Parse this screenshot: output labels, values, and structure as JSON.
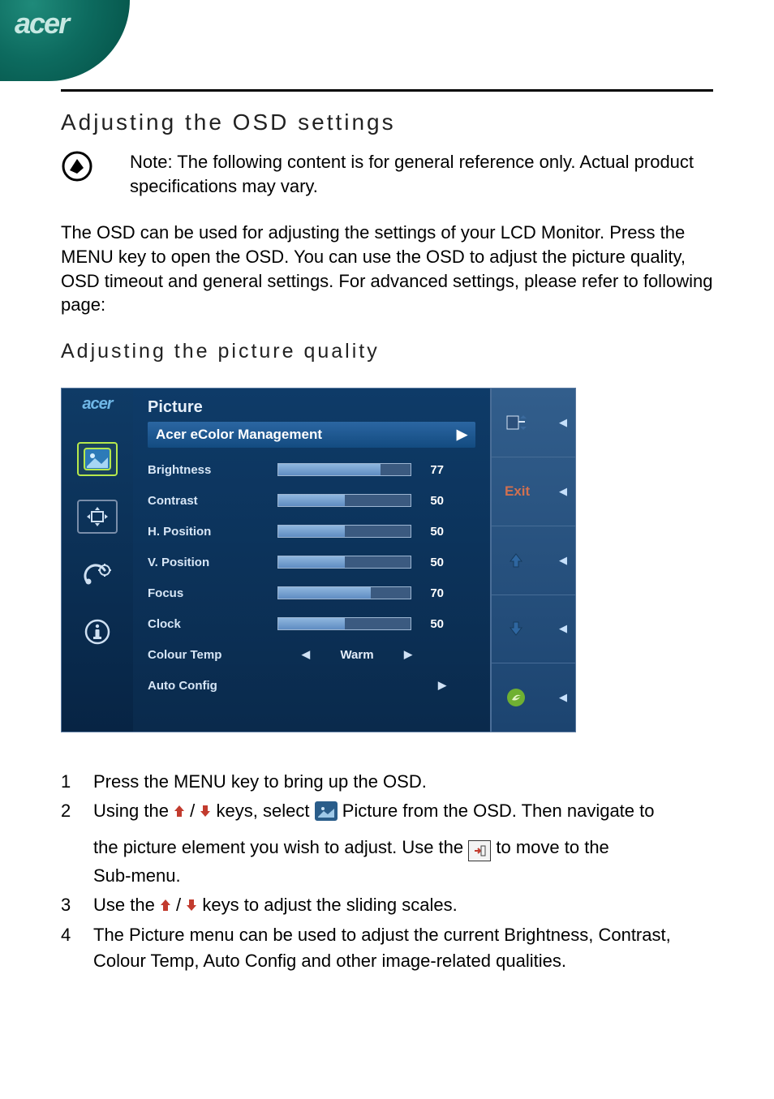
{
  "brand": "acer",
  "heading_main": "Adjusting the OSD settings",
  "note_text": "Note: The following content is for general reference only. Actual product specifications may vary.",
  "body_para": "The OSD can be used for adjusting the settings of your LCD Monitor. Press the MENU key to open the OSD. You can use the OSD to adjust the picture quality, OSD timeout  and general settings. For advanced settings, please refer to following page:",
  "heading_sub": "Adjusting the picture quality",
  "osd": {
    "brand_small": "acer",
    "title": "Picture",
    "submenu_label": "Acer eColor Management",
    "rows": [
      {
        "label": "Brightness",
        "value": 77
      },
      {
        "label": "Contrast",
        "value": 50
      },
      {
        "label": "H. Position",
        "value": 50
      },
      {
        "label": "V. Position",
        "value": 50
      },
      {
        "label": "Focus",
        "value": 70
      },
      {
        "label": "Clock",
        "value": 50
      }
    ],
    "colour_temp": {
      "label": "Colour Temp",
      "value": "Warm"
    },
    "auto_config_label": "Auto Config",
    "right_exit": "Exit"
  },
  "steps": {
    "s1": "Press the MENU key to bring up the OSD.",
    "s2_a": "Using the ",
    "s2_b": " keys, select ",
    "s2_c": " Picture from the OSD. Then navigate to",
    "s2_d": "the picture element you wish to adjust. Use the ",
    "s2_e": " to move to the",
    "s2_f": " Sub-menu.",
    "s3": "Use the ",
    "s3_b": " keys to adjust the sliding scales.",
    "s4": "The Picture menu can be used to adjust the current Brightness, Contrast, Colour Temp, Auto Config and other image-related qualities.",
    "slash": " / "
  }
}
